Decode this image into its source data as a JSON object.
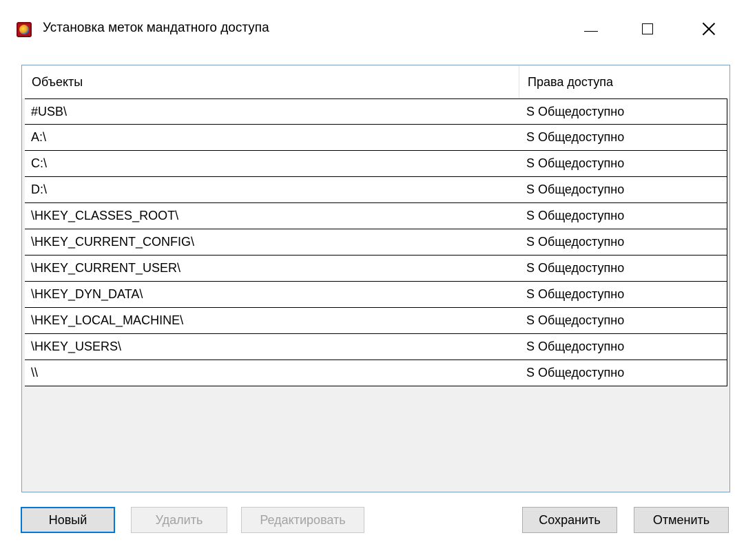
{
  "window": {
    "title": "Установка меток мандатного доступа",
    "icon": "app-shield-icon",
    "controls": {
      "minimize": "minimize-icon",
      "maximize": "maximize-icon",
      "close": "close-icon"
    }
  },
  "grid": {
    "columns": {
      "objects": "Объекты",
      "rights": "Права доступа"
    },
    "rows": [
      {
        "object": "#USB\\",
        "rights": "S Общедоступно"
      },
      {
        "object": "A:\\",
        "rights": "S Общедоступно"
      },
      {
        "object": "C:\\",
        "rights": "S Общедоступно"
      },
      {
        "object": "D:\\",
        "rights": "S Общедоступно"
      },
      {
        "object": "\\HKEY_CLASSES_ROOT\\",
        "rights": "S Общедоступно"
      },
      {
        "object": "\\HKEY_CURRENT_CONFIG\\",
        "rights": "S Общедоступно"
      },
      {
        "object": "\\HKEY_CURRENT_USER\\",
        "rights": "S Общедоступно"
      },
      {
        "object": "\\HKEY_DYN_DATA\\",
        "rights": "S Общедоступно"
      },
      {
        "object": "\\HKEY_LOCAL_MACHINE\\",
        "rights": "S Общедоступно"
      },
      {
        "object": "\\HKEY_USERS\\",
        "rights": "S Общедоступно"
      },
      {
        "object": "\\\\",
        "rights": "S Общедоступно"
      }
    ]
  },
  "buttons": {
    "new": "Новый",
    "delete": "Удалить",
    "edit": "Редактировать",
    "save": "Сохранить",
    "cancel": "Отменить"
  },
  "colors": {
    "focus_border": "#0078d7",
    "disabled_text": "#a3a3a3",
    "grid_frame": "#7aa0c8"
  }
}
